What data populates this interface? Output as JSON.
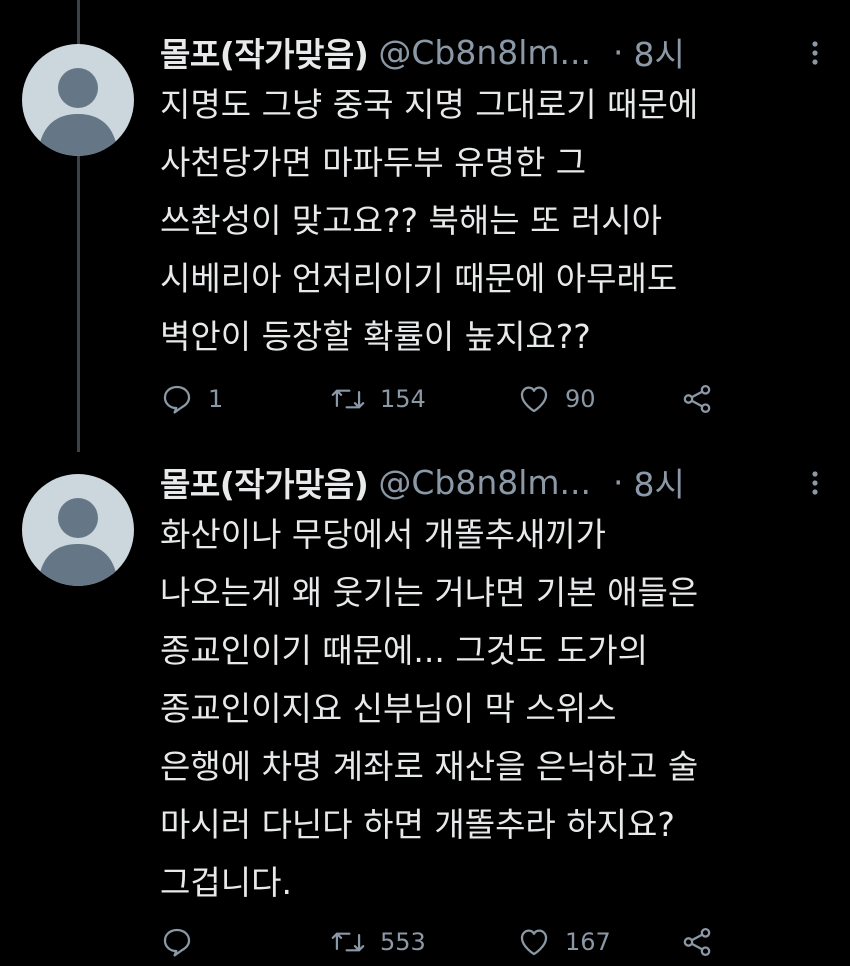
{
  "tweets": [
    {
      "display_name": "몰포(작가맞음)",
      "handle": "@Cb8n8lm...",
      "separator": "·",
      "time": "8시",
      "text": "지명도 그냥 중국 지명 그대로기 때문에\n사천당가면 마파두부 유명한 그\n쓰촨성이 맞고요?? 북해는 또 러시아\n시베리아 언저리이기 때문에 아무래도\n벽안이 등장할 확률이 높지요??",
      "replies": "1",
      "retweets": "154",
      "likes": "90"
    },
    {
      "display_name": "몰포(작가맞음)",
      "handle": "@Cb8n8lm...",
      "separator": "·",
      "time": "8시",
      "text": "화산이나 무당에서 개똘추새끼가\n나오는게 왜 웃기는 거냐면 기본 애들은\n종교인이기 때문에... 그것도 도가의\n종교인이지요 신부님이 막 스위스\n은행에 차명 계좌로 재산을 은닉하고 술\n마시러 다닌다 하면 개똘추라 하지요?\n그겁니다.",
      "replies": "",
      "retweets": "553",
      "likes": "167"
    }
  ],
  "icons": {
    "reply": "reply-icon",
    "retweet": "retweet-icon",
    "like": "heart-icon",
    "share": "share-icon",
    "more": "more-options-icon",
    "avatar": "default-avatar-icon"
  },
  "colors": {
    "background": "#000000",
    "text": "#e7e9ea",
    "secondary": "#8b98a5",
    "thread_line": "#3d4248",
    "avatar_bg": "#ccd6dd",
    "avatar_fg": "#657786"
  }
}
